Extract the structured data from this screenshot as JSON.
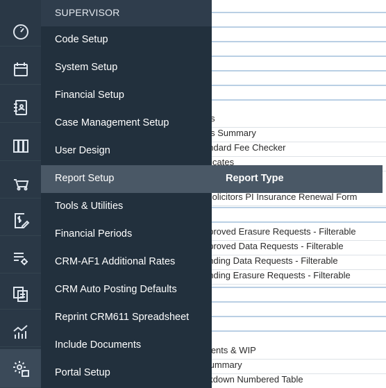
{
  "rail": {
    "icons": [
      "dashboard-icon",
      "calendar-icon",
      "contacts-book-icon",
      "library-books-icon",
      "basket-icon",
      "billing-edit-icon",
      "list-settings-icon",
      "documents-icon",
      "analytics-icon",
      "settings-cog-icon"
    ]
  },
  "menu": {
    "header": "SUPERVISOR",
    "items": [
      "Code Setup",
      "System Setup",
      "Financial Setup",
      "Case Management Setup",
      "User Design",
      "Report Setup",
      "Tools & Utilities",
      "Financial Periods",
      "CRM-AF1 Additional Rates",
      "CRM Auto Posting Defaults",
      "Reprint CRM611 Spreadsheet",
      "Include Documents",
      "Portal Setup"
    ],
    "active_item": "Report Setup"
  },
  "submenu": {
    "item": "Report Type"
  },
  "background": {
    "rows": [
      "sts",
      "sts Summary",
      "andard Fee Checker",
      "olicates",
      "Solicitors PI Insurance Renewal Form",
      "pproved Erasure Requests - Filterable",
      "pproved Data Requests - Filterable",
      "ending Data Requests - Filterable",
      "ending Erasure Requests - Filterable",
      "ments & WIP",
      "Summary",
      "akdown Numbered Table"
    ]
  }
}
